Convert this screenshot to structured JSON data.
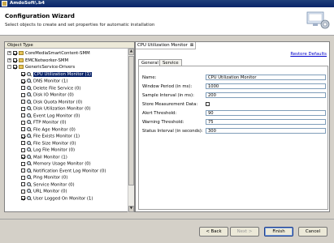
{
  "window": {
    "title": "AmdoSoft\\.b4",
    "icon": "app-icon"
  },
  "header": {
    "title": "Configuration Wizard",
    "subtitle": "Select objects to create and set properties for automatic installation",
    "icon": "wizard-icon"
  },
  "tree": {
    "header": "Object Type",
    "items": [
      {
        "label": "CoreMediaSmartContent-SMM",
        "level": 0,
        "expander": "+",
        "checked": true,
        "icon": "folder-icon"
      },
      {
        "label": "EMCNetworker-SMM",
        "level": 0,
        "expander": "+",
        "checked": true,
        "icon": "folder-icon"
      },
      {
        "label": "GenericService-Drivers",
        "level": 0,
        "expander": "-",
        "checked": true,
        "icon": "folder-icon"
      },
      {
        "label": "CPU Utilization Monitor (1)",
        "level": 1,
        "checked": true,
        "selected": true,
        "icon": "magnifier-icon"
      },
      {
        "label": "DNS Monitor (1)",
        "level": 1,
        "checked": true,
        "icon": "magnifier-icon"
      },
      {
        "label": "Delete File Service (0)",
        "level": 1,
        "checked": false,
        "icon": "magnifier-icon"
      },
      {
        "label": "Disk IO Monitor (0)",
        "level": 1,
        "checked": false,
        "icon": "magnifier-icon"
      },
      {
        "label": "Disk Quota Monitor (0)",
        "level": 1,
        "checked": false,
        "icon": "magnifier-icon"
      },
      {
        "label": "Disk Utilization Monitor (0)",
        "level": 1,
        "checked": false,
        "icon": "magnifier-icon"
      },
      {
        "label": "Event Log Monitor (0)",
        "level": 1,
        "checked": false,
        "icon": "magnifier-icon"
      },
      {
        "label": "FTP Monitor (0)",
        "level": 1,
        "checked": false,
        "icon": "magnifier-icon"
      },
      {
        "label": "File Age Monitor (0)",
        "level": 1,
        "checked": false,
        "icon": "magnifier-icon"
      },
      {
        "label": "File Exists Monitor (1)",
        "level": 1,
        "checked": true,
        "icon": "magnifier-icon"
      },
      {
        "label": "File Size Monitor (0)",
        "level": 1,
        "checked": false,
        "icon": "magnifier-icon"
      },
      {
        "label": "Log File Monitor (0)",
        "level": 1,
        "checked": false,
        "icon": "magnifier-icon"
      },
      {
        "label": "Mail Monitor (1)",
        "level": 1,
        "checked": true,
        "icon": "magnifier-icon"
      },
      {
        "label": "Memory Usage Monitor (0)",
        "level": 1,
        "checked": false,
        "icon": "magnifier-icon"
      },
      {
        "label": "Notification Event Log Monitor (0)",
        "level": 1,
        "checked": false,
        "icon": "magnifier-icon"
      },
      {
        "label": "Ping Monitor (0)",
        "level": 1,
        "checked": false,
        "icon": "magnifier-icon"
      },
      {
        "label": "Service Monitor (0)",
        "level": 1,
        "checked": false,
        "icon": "magnifier-icon"
      },
      {
        "label": "URL Monitor (0)",
        "level": 1,
        "checked": false,
        "icon": "magnifier-icon"
      },
      {
        "label": "User Logged On Monitor (1)",
        "level": 1,
        "checked": true,
        "icon": "magnifier-icon"
      }
    ]
  },
  "editor": {
    "tab_label": "CPU Utilization Monitor",
    "restore_link": "Restore Defaults",
    "sub_tabs": [
      "General",
      "Service"
    ],
    "fields": [
      {
        "label": "Name:",
        "type": "text",
        "value": "CPU Utilization Monitor"
      },
      {
        "label": "Window Period (in ms):",
        "type": "text",
        "value": "1000"
      },
      {
        "label": "Sample Interval (in ms):",
        "type": "text",
        "value": "200"
      },
      {
        "label": "Store Measurement Data:",
        "type": "checkbox",
        "checked": false
      },
      {
        "label": "Alert Threshold:",
        "type": "text",
        "value": "90"
      },
      {
        "label": "Warning Threshold:",
        "type": "text",
        "value": "75"
      },
      {
        "label": "Status Interval (in seconds):",
        "type": "text",
        "value": "300"
      }
    ]
  },
  "buttons": {
    "back": "< Back",
    "next": "Next >",
    "finish": "Finish",
    "cancel": "Cancel"
  }
}
